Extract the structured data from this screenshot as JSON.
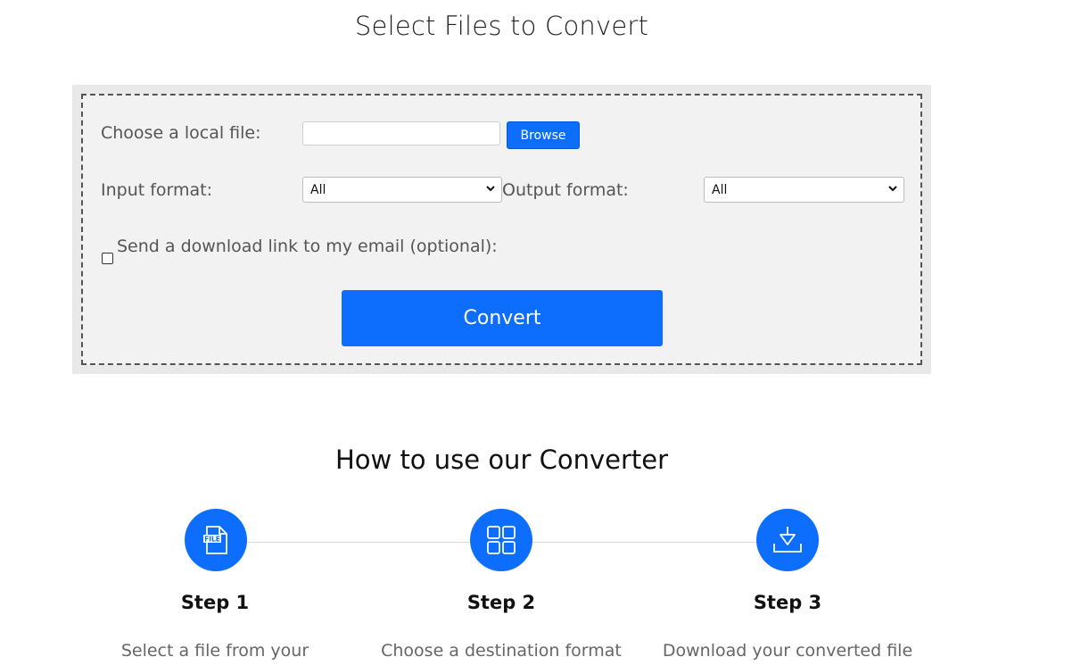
{
  "page": {
    "title": "Select Files to Convert"
  },
  "form": {
    "choose_file_label": "Choose a local file:",
    "file_input_value": "",
    "browse_label": "Browse",
    "input_format_label": "Input format:",
    "input_format_selected": "All",
    "output_format_label": "Output format:",
    "output_format_selected": "All",
    "email_checkbox_label": "Send a download link to my email (optional):",
    "email_checkbox_checked": false,
    "convert_label": "Convert"
  },
  "howto": {
    "heading": "How to use our Converter",
    "steps": [
      {
        "title": "Step 1",
        "description": "Select a file from your",
        "icon": "file-icon"
      },
      {
        "title": "Step 2",
        "description": "Choose a destination format",
        "icon": "grid-icon"
      },
      {
        "title": "Step 3",
        "description": "Download your converted file",
        "icon": "download-icon"
      }
    ]
  },
  "colors": {
    "accent": "#0d6efd",
    "panel_bg": "#e9e9e9",
    "panel_inner_bg": "#f2f2f2",
    "label_text": "#555555"
  }
}
